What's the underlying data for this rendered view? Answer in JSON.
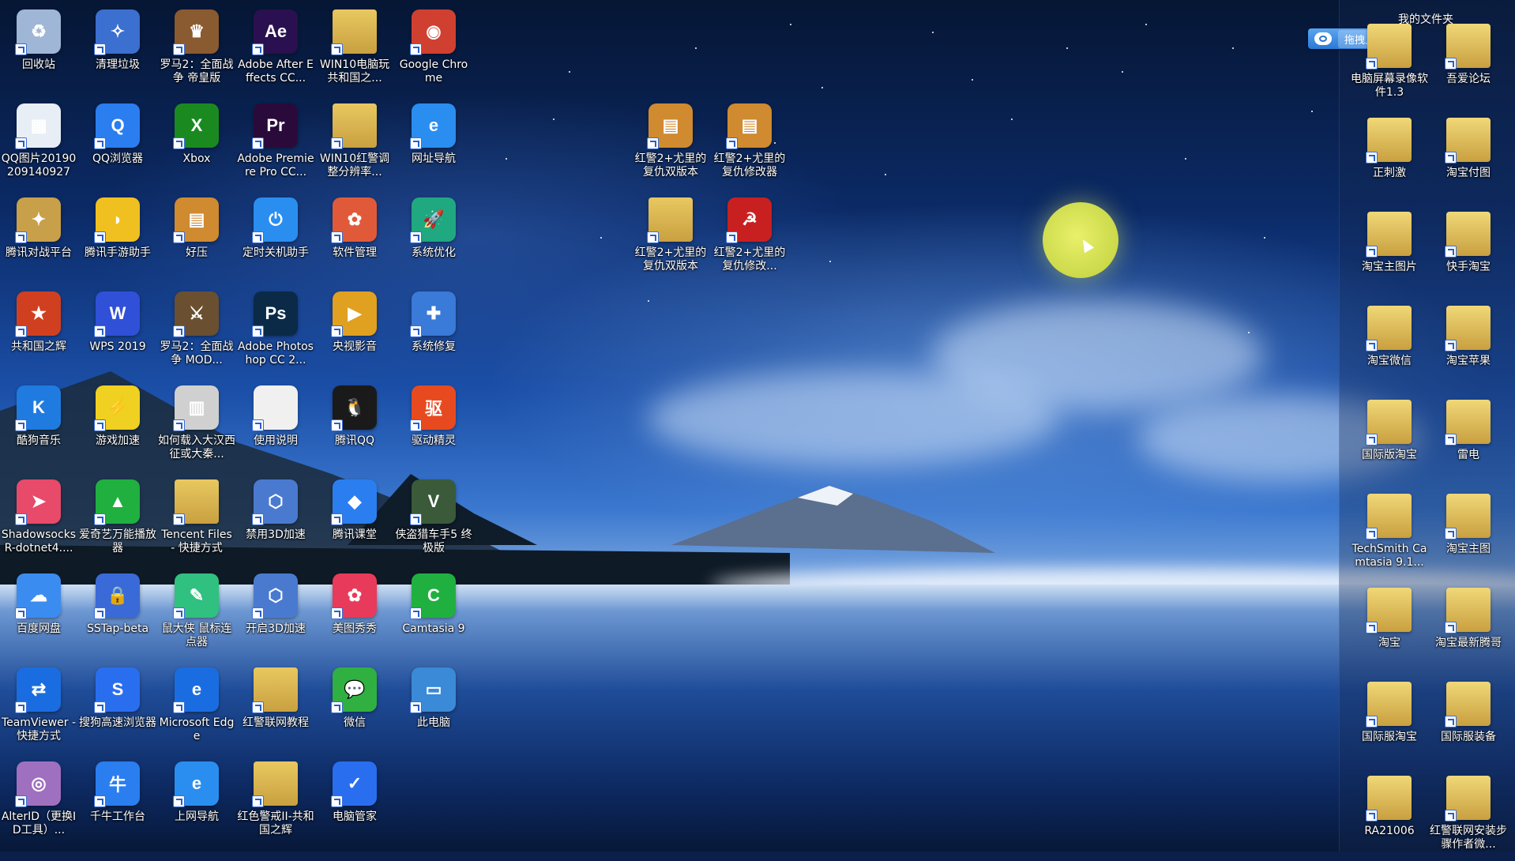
{
  "panel": {
    "title": "我的文件夹",
    "upload_button": "拖拽上传",
    "items": [
      {
        "label": "电脑屏幕录像软件1.3",
        "icon": "folder-icon"
      },
      {
        "label": "吾爱论坛",
        "icon": "folder-icon"
      },
      {
        "label": "正刺激",
        "icon": "folder-icon"
      },
      {
        "label": "淘宝付图",
        "icon": "folder-icon"
      },
      {
        "label": "淘宝主图片",
        "icon": "folder-icon"
      },
      {
        "label": "快手淘宝",
        "icon": "folder-icon"
      },
      {
        "label": "淘宝微信",
        "icon": "folder-icon"
      },
      {
        "label": "淘宝苹果",
        "icon": "folder-icon"
      },
      {
        "label": "国际版淘宝",
        "icon": "folder-icon"
      },
      {
        "label": "雷电",
        "icon": "folder-icon"
      },
      {
        "label": "TechSmith Camtasia 9.1...",
        "icon": "folder-icon"
      },
      {
        "label": "淘宝主图",
        "icon": "folder-icon"
      },
      {
        "label": "淘宝",
        "icon": "folder-icon"
      },
      {
        "label": "淘宝最新腾哥",
        "icon": "folder-icon"
      },
      {
        "label": "国际服淘宝",
        "icon": "folder-icon"
      },
      {
        "label": "国际服装备",
        "icon": "folder-icon"
      },
      {
        "label": "RA21006",
        "icon": "folder-icon"
      },
      {
        "label": "红警联网安装步骤作者微...",
        "icon": "folder-icon"
      }
    ]
  },
  "desktop": {
    "icons": [
      {
        "label": "回收站",
        "icon": "recycle-bin-icon",
        "glyph": "♻",
        "color": "#9fb6d6"
      },
      {
        "label": "QQ图片20190209140927",
        "icon": "image-file-icon",
        "glyph": "▦",
        "color": "#e8eef6"
      },
      {
        "label": "腾讯对战平台",
        "icon": "tencent-battle-icon",
        "glyph": "✦",
        "color": "#c8a04a"
      },
      {
        "label": "共和国之辉",
        "icon": "game-republic-icon",
        "glyph": "★",
        "color": "#d04020"
      },
      {
        "label": "酷狗音乐",
        "icon": "kugou-icon",
        "glyph": "K",
        "color": "#1f7be0"
      },
      {
        "label": "Shadowsocks R-dotnet4....",
        "icon": "shadowsocks-icon",
        "glyph": "➤",
        "color": "#e84a6a"
      },
      {
        "label": "百度网盘",
        "icon": "baidu-netdisk-icon",
        "glyph": "☁",
        "color": "#3a8cf0"
      },
      {
        "label": "TeamViewer - 快捷方式",
        "icon": "teamviewer-icon",
        "glyph": "⇄",
        "color": "#1a6de0"
      },
      {
        "label": "AlterID（更换ID工具）...",
        "icon": "alterid-icon",
        "glyph": "◎",
        "color": "#a070c0"
      },
      {
        "label": "清理垃圾",
        "icon": "cleanup-icon",
        "glyph": "✧",
        "color": "#3b6fd0"
      },
      {
        "label": "QQ浏览器",
        "icon": "qq-browser-icon",
        "glyph": "Q",
        "color": "#2a7ef0"
      },
      {
        "label": "腾讯手游助手",
        "icon": "tencent-mobile-game-icon",
        "glyph": "◗",
        "color": "#f0c020"
      },
      {
        "label": "WPS 2019",
        "icon": "wps-icon",
        "glyph": "W",
        "color": "#3050d8"
      },
      {
        "label": "游戏加速",
        "icon": "game-accelerator-icon",
        "glyph": "⚡",
        "color": "#f0d020"
      },
      {
        "label": "爱奇艺万能播放器",
        "icon": "iqiyi-player-icon",
        "glyph": "▲",
        "color": "#20b040"
      },
      {
        "label": "SSTap-beta",
        "icon": "sstap-icon",
        "glyph": "🔒",
        "color": "#3a6ad8"
      },
      {
        "label": "搜狗高速浏览器",
        "icon": "sogou-browser-icon",
        "glyph": "S",
        "color": "#2a6ef0"
      },
      {
        "label": "千牛工作台",
        "icon": "qianniu-icon",
        "glyph": "牛",
        "color": "#2a7ef0"
      },
      {
        "label": "罗马2：全面战争 帝皇版",
        "icon": "rome2-icon",
        "glyph": "♛",
        "color": "#8a5a30"
      },
      {
        "label": "Xbox",
        "icon": "xbox-icon",
        "glyph": "X",
        "color": "#1a8a20"
      },
      {
        "label": "好压",
        "icon": "haozip-icon",
        "glyph": "▤",
        "color": "#d08a30"
      },
      {
        "label": "罗马2：全面战争 MOD...",
        "icon": "rome2-mod-icon",
        "glyph": "⚔",
        "color": "#6a5030"
      },
      {
        "label": "如何载入大汉西征或大秦...",
        "icon": "text-file-icon",
        "glyph": "▥",
        "color": "#d0d0d0"
      },
      {
        "label": "Tencent Files - 快捷方式",
        "icon": "folder-icon",
        "glyph": "",
        "color": "#e8c860"
      },
      {
        "label": "鼠大侠 鼠标连点器",
        "icon": "mouse-clicker-icon",
        "glyph": "✎",
        "color": "#30c080"
      },
      {
        "label": "Microsoft Edge",
        "icon": "edge-icon",
        "glyph": "e",
        "color": "#1a6de0"
      },
      {
        "label": "上网导航",
        "icon": "ie-nav-icon",
        "glyph": "e",
        "color": "#2a8ef0"
      },
      {
        "label": "Adobe After Effects CC...",
        "icon": "after-effects-icon",
        "glyph": "Ae",
        "color": "#2a1050"
      },
      {
        "label": "Adobe Premiere Pro CC...",
        "icon": "premiere-icon",
        "glyph": "Pr",
        "color": "#2a0a3a"
      },
      {
        "label": "定时关机助手",
        "icon": "shutdown-timer-icon",
        "glyph": "⏻",
        "color": "#2a8ef0"
      },
      {
        "label": "Adobe Photoshop CC 2...",
        "icon": "photoshop-icon",
        "glyph": "Ps",
        "color": "#0a2a48"
      },
      {
        "label": "使用说明",
        "icon": "text-file-icon",
        "glyph": "",
        "color": "#f0f0f0"
      },
      {
        "label": "禁用3D加速",
        "icon": "disable-3d-icon",
        "glyph": "⬡",
        "color": "#4a7ad0"
      },
      {
        "label": "开启3D加速",
        "icon": "enable-3d-icon",
        "glyph": "⬡",
        "color": "#4a7ad0"
      },
      {
        "label": "红警联网教程",
        "icon": "folder-icon",
        "glyph": "",
        "color": "#e8c860"
      },
      {
        "label": "红色警戒II-共和国之辉",
        "icon": "folder-icon",
        "glyph": "",
        "color": "#e8c860"
      },
      {
        "label": "WIN10电脑玩共和国之...",
        "icon": "folder-icon",
        "glyph": "",
        "color": "#e8c860"
      },
      {
        "label": "WIN10红警调整分辨率...",
        "icon": "folder-icon",
        "glyph": "",
        "color": "#e8c860"
      },
      {
        "label": "软件管理",
        "icon": "software-manager-icon",
        "glyph": "✿",
        "color": "#e05a3a"
      },
      {
        "label": "央视影音",
        "icon": "cctv-icon",
        "glyph": "▶",
        "color": "#e0a020"
      },
      {
        "label": "腾讯QQ",
        "icon": "qq-icon",
        "glyph": "🐧",
        "color": "#1a1a1a"
      },
      {
        "label": "腾讯课堂",
        "icon": "tencent-classroom-icon",
        "glyph": "◆",
        "color": "#2a7ef0"
      },
      {
        "label": "美图秀秀",
        "icon": "meitu-icon",
        "glyph": "✿",
        "color": "#e83a5a"
      },
      {
        "label": "微信",
        "icon": "wechat-icon",
        "glyph": "💬",
        "color": "#30b040"
      },
      {
        "label": "电脑管家",
        "icon": "pc-manager-icon",
        "glyph": "✓",
        "color": "#2a6ef0"
      },
      {
        "label": "Google Chrome",
        "icon": "chrome-icon",
        "glyph": "◉",
        "color": "#d04030"
      },
      {
        "label": "网址导航",
        "icon": "ie-icon",
        "glyph": "e",
        "color": "#2a8ef0"
      },
      {
        "label": "系统优化",
        "icon": "system-optimize-icon",
        "glyph": "🚀",
        "color": "#20a880"
      },
      {
        "label": "系统修复",
        "icon": "system-repair-icon",
        "glyph": "✚",
        "color": "#3a7ad8"
      },
      {
        "label": "驱动精灵",
        "icon": "driver-genius-icon",
        "glyph": "驱",
        "color": "#e84a20"
      },
      {
        "label": "侠盗猎车手5 终极版",
        "icon": "gta5-icon",
        "glyph": "V",
        "color": "#3a5a3a"
      },
      {
        "label": "Camtasia 9",
        "icon": "camtasia-icon",
        "glyph": "C",
        "color": "#20b040"
      },
      {
        "label": "此电脑",
        "icon": "this-pc-icon",
        "glyph": "▭",
        "color": "#3a8ad8"
      },
      {
        "label": "红警2+尤里的复仇双版本",
        "icon": "archive-icon",
        "glyph": "▤",
        "color": "#d08a30"
      },
      {
        "label": "红警2+尤里的复仇修改器",
        "icon": "archive-icon",
        "glyph": "▤",
        "color": "#d08a30"
      },
      {
        "label": "红警2+尤里的复仇双版本",
        "icon": "folder-icon",
        "glyph": "",
        "color": "#e8c860"
      },
      {
        "label": "红警2+尤里的复仇修改...",
        "icon": "ra2-trainer-icon",
        "glyph": "☭",
        "color": "#c82020"
      }
    ]
  }
}
